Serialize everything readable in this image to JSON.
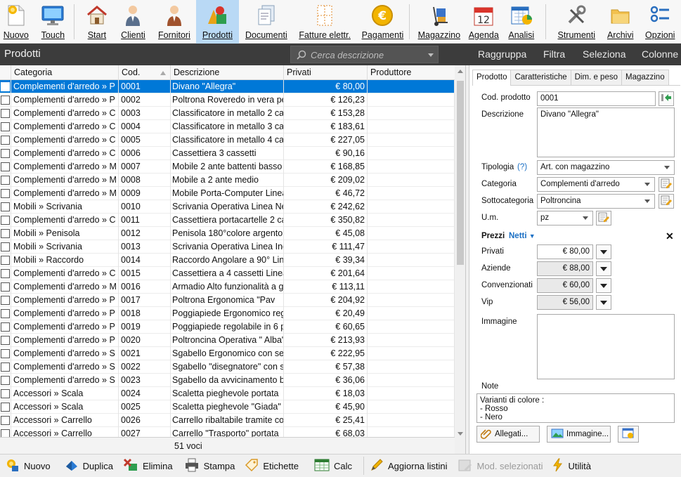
{
  "ribbon": {
    "items": [
      {
        "id": "nuovo",
        "label": "Nuovo",
        "icon": "new-document-icon"
      },
      {
        "id": "touch",
        "label": "Touch",
        "icon": "monitor-icon"
      },
      {
        "id": "start",
        "label": "Start",
        "icon": "home-icon"
      },
      {
        "id": "clienti",
        "label": "Clienti",
        "icon": "customer-icon"
      },
      {
        "id": "fornitori",
        "label": "Fornitori",
        "icon": "supplier-icon"
      },
      {
        "id": "prodotti",
        "label": "Prodotti",
        "icon": "products-icon"
      },
      {
        "id": "documenti",
        "label": "Documenti",
        "icon": "documents-icon"
      },
      {
        "id": "fatture",
        "label": "Fatture elettr.",
        "icon": "einvoice-icon"
      },
      {
        "id": "pagamenti",
        "label": "Pagamenti",
        "icon": "euro-coin-icon"
      },
      {
        "id": "magazzino",
        "label": "Magazzino",
        "icon": "handtruck-icon"
      },
      {
        "id": "agenda",
        "label": "Agenda",
        "icon": "calendar-icon"
      },
      {
        "id": "analisi",
        "label": "Analisi",
        "icon": "chart-icon"
      },
      {
        "id": "strumenti",
        "label": "Strumenti",
        "icon": "tools-icon"
      },
      {
        "id": "archivi",
        "label": "Archivi",
        "icon": "folders-icon"
      },
      {
        "id": "opzioni",
        "label": "Opzioni",
        "icon": "options-icon"
      }
    ],
    "agenda_day": "12"
  },
  "section": {
    "title": "Prodotti",
    "search_placeholder": "Cerca descrizione",
    "actions": [
      "Raggruppa",
      "Filtra",
      "Seleziona",
      "Colonne"
    ]
  },
  "grid": {
    "columns": [
      "Categoria",
      "Cod.",
      "Descrizione",
      "Privati",
      "Produttore"
    ],
    "rows": [
      {
        "cat": "Complementi d'arredo  »  P",
        "cod": "0001",
        "desc": "Divano \"Allegra\"",
        "price": "€ 80,00",
        "prod": "",
        "selected": true
      },
      {
        "cat": "Complementi d'arredo  »  P",
        "cod": "0002",
        "desc": "Poltrona Roveredo in vera pe",
        "price": "€ 126,23",
        "prod": ""
      },
      {
        "cat": "Complementi d'arredo  »  C",
        "cod": "0003",
        "desc": "Classificatore in metallo 2 cas",
        "price": "€ 153,28",
        "prod": ""
      },
      {
        "cat": "Complementi d'arredo  »  C",
        "cod": "0004",
        "desc": "Classificatore in metallo 3 cas",
        "price": "€ 183,61",
        "prod": ""
      },
      {
        "cat": "Complementi d'arredo  »  C",
        "cod": "0005",
        "desc": "Classificatore in metallo 4 cas",
        "price": "€ 227,05",
        "prod": ""
      },
      {
        "cat": "Complementi d'arredo  »  C",
        "cod": "0006",
        "desc": "Cassettiera 3 cassetti",
        "price": "€ 90,16",
        "prod": ""
      },
      {
        "cat": "Complementi d'arredo  »  M",
        "cod": "0007",
        "desc": "Mobile 2 ante battenti basso",
        "price": "€ 168,85",
        "prod": ""
      },
      {
        "cat": "Complementi d'arredo  »  M",
        "cod": "0008",
        "desc": "Mobile a 2 ante medio",
        "price": "€ 209,02",
        "prod": ""
      },
      {
        "cat": "Complementi d'arredo  »  M",
        "cod": "0009",
        "desc": "Mobile Porta-Computer Linea",
        "price": "€ 46,72",
        "prod": ""
      },
      {
        "cat": "Mobili  »  Scrivania",
        "cod": "0010",
        "desc": "Scrivania Operativa Linea Nev",
        "price": "€ 242,62",
        "prod": ""
      },
      {
        "cat": "Complementi d'arredo  »  C",
        "cod": "0011",
        "desc": "Cassettiera portacartelle 2 ca",
        "price": "€ 350,82",
        "prod": ""
      },
      {
        "cat": "Mobili  »  Penisola",
        "cod": "0012",
        "desc": "Penisola 180°colore argento",
        "price": "€ 45,08",
        "prod": ""
      },
      {
        "cat": "Mobili  »  Scrivania",
        "cod": "0013",
        "desc": "Scrivania Operativa Linea Inc",
        "price": "€ 111,47",
        "prod": ""
      },
      {
        "cat": "Mobili  »  Raccordo",
        "cod": "0014",
        "desc": "Raccordo Angolare a 90° Lin",
        "price": "€ 39,34",
        "prod": ""
      },
      {
        "cat": "Complementi d'arredo  »  C",
        "cod": "0015",
        "desc": "Cassettiera a 4 cassetti Linea",
        "price": "€ 201,64",
        "prod": ""
      },
      {
        "cat": "Complementi d'arredo  »  M",
        "cod": "0016",
        "desc": "Armadio Alto funzionalità a g",
        "price": "€ 113,11",
        "prod": ""
      },
      {
        "cat": "Complementi d'arredo  »  P",
        "cod": "0017",
        "desc": "Poltrona Ergonomica \"Pav",
        "price": "€ 204,92",
        "prod": ""
      },
      {
        "cat": "Complementi d'arredo  »  P",
        "cod": "0018",
        "desc": "Poggiapiede Ergonomico reg",
        "price": "€ 20,49",
        "prod": ""
      },
      {
        "cat": "Complementi d'arredo  »  P",
        "cod": "0019",
        "desc": "Poggiapiede regolabile in 6 p",
        "price": "€ 60,65",
        "prod": ""
      },
      {
        "cat": "Complementi d'arredo  »  P",
        "cod": "0020",
        "desc": "Poltroncina Operativa \" Alba\"",
        "price": "€ 213,93",
        "prod": ""
      },
      {
        "cat": "Complementi d'arredo  »  S",
        "cod": "0021",
        "desc": "Sgabello Ergonomico con sed",
        "price": "€ 222,95",
        "prod": ""
      },
      {
        "cat": "Complementi d'arredo  »  S",
        "cod": "0022",
        "desc": "Sgabello \"disegnatore\" con s",
        "price": "€ 57,38",
        "prod": ""
      },
      {
        "cat": "Complementi d'arredo  »  S",
        "cod": "0023",
        "desc": "Sgabello da avvicinamento b",
        "price": "€ 36,06",
        "prod": ""
      },
      {
        "cat": "Accessori  »  Scala",
        "cod": "0024",
        "desc": "Scaletta pieghevole portata",
        "price": "€ 18,03",
        "prod": ""
      },
      {
        "cat": "Accessori  »  Scala",
        "cod": "0025",
        "desc": "Scaletta pieghevole \"Giada\" p",
        "price": "€ 45,90",
        "prod": ""
      },
      {
        "cat": "Accessori  »  Carrello",
        "cod": "0026",
        "desc": "Carrello ribaltabile tramite cor",
        "price": "€ 25,41",
        "prod": ""
      },
      {
        "cat": "Accessori  »  Carrello",
        "cod": "0027",
        "desc": "Carrello \"Trasporto\" portata",
        "price": "€ 68,03",
        "prod": ""
      }
    ],
    "footer_count": "51 voci"
  },
  "detail": {
    "tabs": [
      "Prodotto",
      "Caratteristiche",
      "Dim. e peso",
      "Magazzino"
    ],
    "cod_label": "Cod. prodotto",
    "cod_value": "0001",
    "desc_label": "Descrizione",
    "desc_value": "Divano \"Allegra\"",
    "tipologia_label": "Tipologia",
    "tipologia_help": "(?)",
    "tipologia_value": "Art. con magazzino",
    "categoria_label": "Categoria",
    "categoria_value": "Complementi d'arredo",
    "sottocat_label": "Sottocategoria",
    "sottocat_value": "Poltroncina",
    "um_label": "U.m.",
    "um_value": "pz",
    "prezzi_label": "Prezzi",
    "prezzi_mode": "Netti",
    "prices": [
      {
        "label": "Privati",
        "value": "€ 80,00"
      },
      {
        "label": "Aziende",
        "value": "€ 88,00"
      },
      {
        "label": "Convenzionati",
        "value": "€ 60,00"
      },
      {
        "label": "Vip",
        "value": "€ 56,00"
      }
    ],
    "immagine_label": "Immagine",
    "note_label": "Note",
    "note_value": "Varianti di colore :\n- Rosso\n- Nero",
    "allegati_label": "Allegati...",
    "immagine_btn_label": "Immagine..."
  },
  "bottombar": {
    "items": [
      {
        "id": "nuovo",
        "label": "Nuovo",
        "icon": "add-icon",
        "disabled": false
      },
      {
        "id": "duplica",
        "label": "Duplica",
        "icon": "duplicate-icon",
        "disabled": false
      },
      {
        "id": "elimina",
        "label": "Elimina",
        "icon": "delete-icon",
        "disabled": false
      },
      {
        "id": "stampa",
        "label": "Stampa",
        "icon": "printer-icon",
        "disabled": false
      },
      {
        "id": "etichette",
        "label": "Etichette",
        "icon": "label-icon",
        "disabled": false
      },
      {
        "id": "calc",
        "label": "Calc",
        "icon": "spreadsheet-icon",
        "disabled": false
      },
      {
        "id": "aggiorna",
        "label": "Aggiorna listini",
        "icon": "pencil-icon",
        "disabled": false
      },
      {
        "id": "mod",
        "label": "Mod. selezionati",
        "icon": "edit-selected-icon",
        "disabled": true
      },
      {
        "id": "utilita",
        "label": "Utilità",
        "icon": "lightning-icon",
        "disabled": false
      }
    ]
  },
  "colors": {
    "selection": "#0078d7",
    "ribbon_active": "#b9d9f5",
    "dark_bar": "#3c3c3c"
  }
}
